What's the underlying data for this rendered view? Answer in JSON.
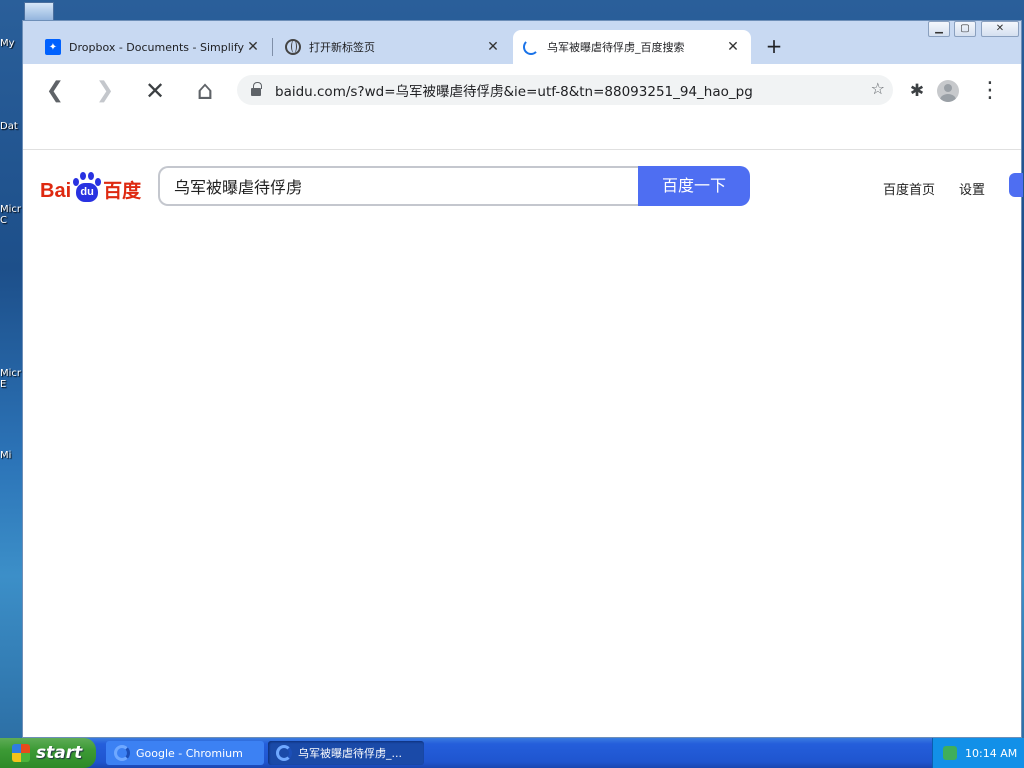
{
  "desktop": {
    "icons": [
      {
        "label": "My"
      },
      {
        "label": "Dat"
      },
      {
        "label": "Micr\nC"
      },
      {
        "label": "Micr\nE"
      },
      {
        "label": "Mi"
      }
    ]
  },
  "browser": {
    "tabs": [
      {
        "title": "Dropbox - Documents - Simplify your",
        "favicon": "dropbox-icon",
        "close": "✕"
      },
      {
        "title": "打开新标签页",
        "favicon": "globe-icon",
        "close": "✕"
      },
      {
        "title": "乌军被曝虐待俘虏_百度搜索",
        "favicon": "loading-spinner-icon",
        "close": "✕"
      }
    ],
    "new_tab": "+",
    "window_controls": {
      "minimize": "▁",
      "maximize": "▢",
      "close": "✕"
    },
    "toolbar": {
      "back": "❮",
      "forward": "❯",
      "stop": "✕",
      "home": "⌂",
      "url": "baidu.com/s?wd=乌军被曝虐待俘虏&ie=utf-8&tn=88093251_94_hao_pg",
      "star": "☆",
      "extensions": "✱",
      "menu": "⋮"
    }
  },
  "baidu": {
    "logo": {
      "latin": "Bai",
      "paw_text": "du",
      "chinese": "百度"
    },
    "search_query": "乌军被曝虐待俘虏",
    "search_button": "百度一下",
    "links": {
      "home": "百度首页",
      "settings": "设置"
    },
    "accent": "#4e6ef2"
  },
  "taskbar": {
    "start_label": "start",
    "tasks": [
      {
        "label": "Google - Chromium"
      },
      {
        "label": "乌军被曝虐待俘虏_..."
      }
    ],
    "clock": "10:14 AM"
  }
}
